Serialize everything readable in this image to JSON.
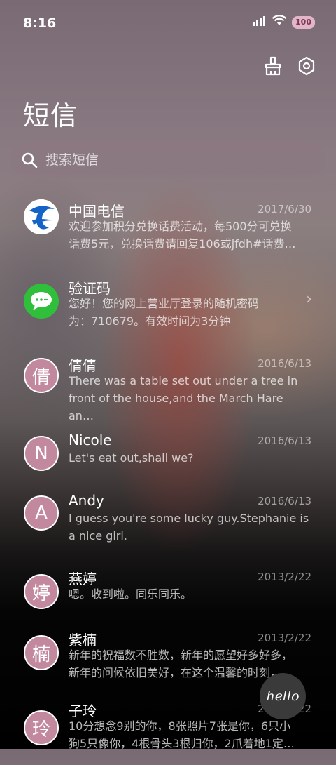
{
  "status": {
    "time": "8:16",
    "battery": "100"
  },
  "header": {
    "title": "短信"
  },
  "search": {
    "placeholder": "搜索短信"
  },
  "colors": {
    "accent_avatar": "#c2889e",
    "telecom_blue": "#1663c7",
    "sms_green": "#2fbf3a"
  },
  "conversations": [
    {
      "name": "中国电信",
      "date": "2017/6/30",
      "avatar": "telecom-logo",
      "line1": "欢迎参加积分兑换话费活动，每500分可兑换",
      "line2": "话费5元，兑换话费请回复106或jfdh#话费…"
    },
    {
      "name": "验证码",
      "date": "",
      "avatar": "chat-bubble",
      "line1": "您好！您的网上营业厅登录的随机密码",
      "line2": "为：710679。有效时间为3分钟"
    },
    {
      "name": "倩倩",
      "date": "2016/6/13",
      "avatar": "倩",
      "line1": "There was a table set out under a tree in",
      "line2": "front of the house,and the March Hare an…"
    },
    {
      "name": "Nicole",
      "date": "2016/6/13",
      "avatar": "N",
      "line1": "Let's eat out,shall we?",
      "line2": ""
    },
    {
      "name": "Andy",
      "date": "2016/6/13",
      "avatar": "A",
      "line1": "I guess you're some lucky guy.Stephanie is",
      "line2": "a nice girl."
    },
    {
      "name": "燕婷",
      "date": "2013/2/22",
      "avatar": "婷",
      "line1": "嗯。收到啦。同乐同乐。",
      "line2": ""
    },
    {
      "name": "紫楠",
      "date": "2013/2/22",
      "avatar": "楠",
      "line1": "新年的祝福数不胜数，新年的愿望好多好多，",
      "line2": "新年的问候依旧美好，在这个温馨的时刻，…"
    },
    {
      "name": "子玲",
      "date": "2013/2/22",
      "avatar": "玲",
      "line1": "10分想念9别的你，8张照片7张是你，6只小",
      "line2": "狗5只像你，4根骨头3根归你，2爪着地1定…"
    }
  ],
  "fab": {
    "label": "hello"
  }
}
